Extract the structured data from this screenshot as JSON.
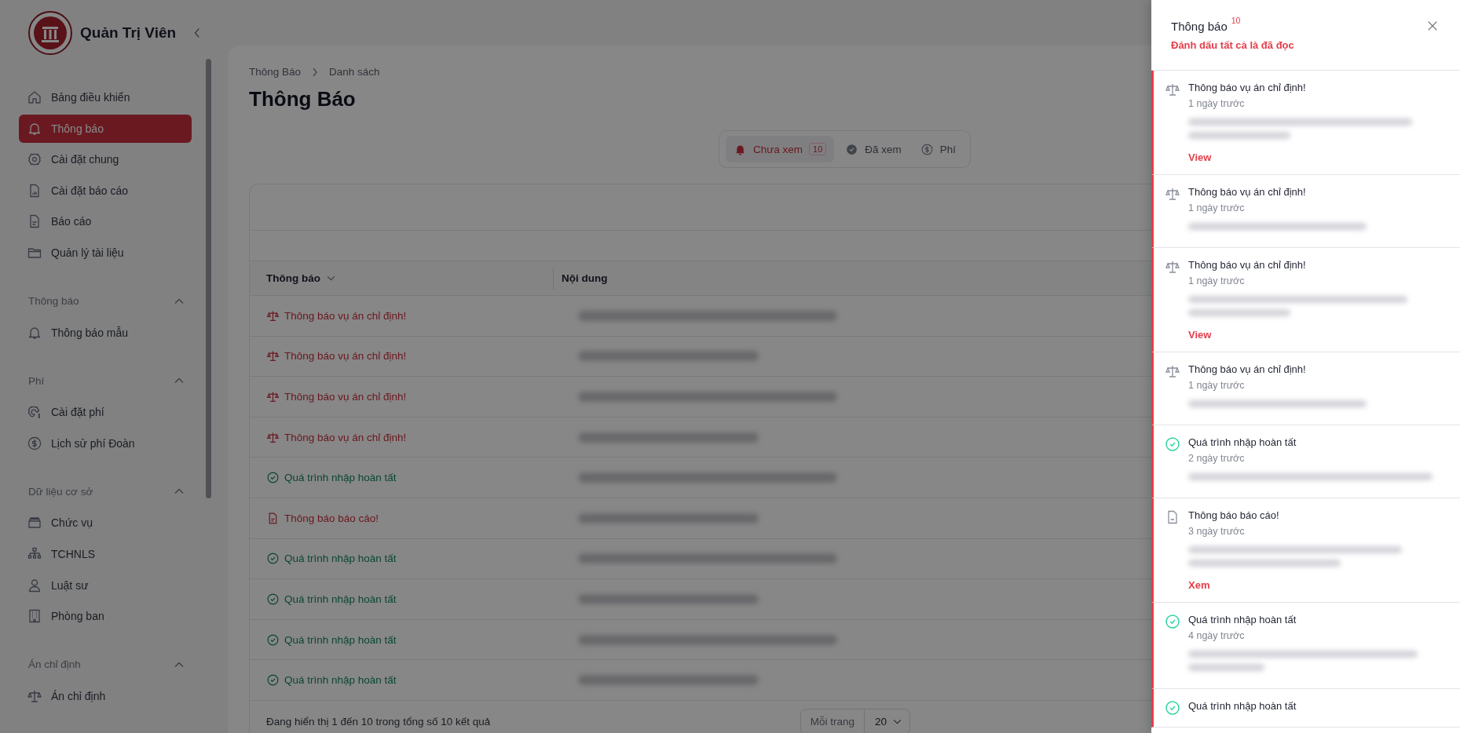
{
  "sidebar": {
    "title": "Quản Trị Viên",
    "items": [
      {
        "label": "Bảng điều khiển",
        "selected": false
      },
      {
        "label": "Thông báo",
        "selected": true
      },
      {
        "label": "Cài đặt chung",
        "selected": false
      },
      {
        "label": "Cài đặt báo cáo",
        "selected": false
      },
      {
        "label": "Báo cáo",
        "selected": false
      },
      {
        "label": "Quản lý tài liệu",
        "selected": false
      }
    ],
    "groups": [
      {
        "title": "Thông báo",
        "expanded": true,
        "items": [
          {
            "label": "Thông báo mẫu",
            "selected": false
          }
        ]
      },
      {
        "title": "Phí",
        "expanded": true,
        "items": [
          {
            "label": "Cài đặt phí",
            "selected": false
          },
          {
            "label": "Lịch sử phí Đoàn",
            "selected": false
          }
        ]
      },
      {
        "title": "Dữ liệu cơ sở",
        "expanded": true,
        "items": [
          {
            "label": "Chức vụ",
            "selected": false
          },
          {
            "label": "TCHNLS",
            "selected": false
          },
          {
            "label": "Luật sư",
            "selected": false
          },
          {
            "label": "Phòng ban",
            "selected": false
          }
        ]
      },
      {
        "title": "Án chỉ định",
        "expanded": true,
        "items": [
          {
            "label": "Án chỉ định",
            "selected": false
          }
        ]
      }
    ]
  },
  "breadcrumb": [
    "Thông Báo",
    "Danh sách"
  ],
  "page_title": "Thông Báo",
  "tabs": [
    {
      "label": "Chưa xem",
      "badge": "10",
      "selected": true
    },
    {
      "label": "Đã xem",
      "selected": false
    },
    {
      "label": "Phí",
      "selected": false
    }
  ],
  "table": {
    "columns": [
      "Thông báo",
      "Nội dung"
    ],
    "rows": [
      {
        "kind": "case",
        "title": "Thông báo vụ án chỉ định!"
      },
      {
        "kind": "case",
        "title": "Thông báo vụ án chỉ định!"
      },
      {
        "kind": "case",
        "title": "Thông báo vụ án chỉ định!"
      },
      {
        "kind": "case",
        "title": "Thông báo vụ án chỉ định!"
      },
      {
        "kind": "import",
        "title": "Quá trình nhập hoàn tất"
      },
      {
        "kind": "report",
        "title": "Thông báo báo cáo!"
      },
      {
        "kind": "import",
        "title": "Quá trình nhập hoàn tất"
      },
      {
        "kind": "import",
        "title": "Quá trình nhập hoàn tất"
      },
      {
        "kind": "import",
        "title": "Quá trình nhập hoàn tất"
      },
      {
        "kind": "import",
        "title": "Quá trình nhập hoàn tất"
      }
    ],
    "summary": "Đang hiển thị 1 đến 10 trong tổng số 10 kết quả",
    "per_page_label": "Mỗi trang",
    "per_page": "20"
  },
  "drawer": {
    "title": "Thông báo",
    "count": "10",
    "mark_all": "Đánh dấu tất cả là đã đọc",
    "items": [
      {
        "kind": "case",
        "title": "Thông báo vụ án chỉ định!",
        "time": "1 ngày trước",
        "action": "View",
        "unread": true
      },
      {
        "kind": "case",
        "title": "Thông báo vụ án chỉ định!",
        "time": "1 ngày trước",
        "unread": true
      },
      {
        "kind": "case",
        "title": "Thông báo vụ án chỉ định!",
        "time": "1 ngày trước",
        "action": "View",
        "unread": true
      },
      {
        "kind": "case",
        "title": "Thông báo vụ án chỉ định!",
        "time": "1 ngày trước",
        "unread": true
      },
      {
        "kind": "import",
        "title": "Quá trình nhập hoàn tất",
        "time": "2 ngày trước",
        "unread": true
      },
      {
        "kind": "report",
        "title": "Thông báo báo cáo!",
        "time": "3 ngày trước",
        "action": "Xem",
        "unread": true
      },
      {
        "kind": "import",
        "title": "Quá trình nhập hoàn tất",
        "time": "4 ngày trước",
        "unread": true
      },
      {
        "kind": "import",
        "title": "Quá trình nhập hoàn tất",
        "unread": true
      }
    ]
  }
}
